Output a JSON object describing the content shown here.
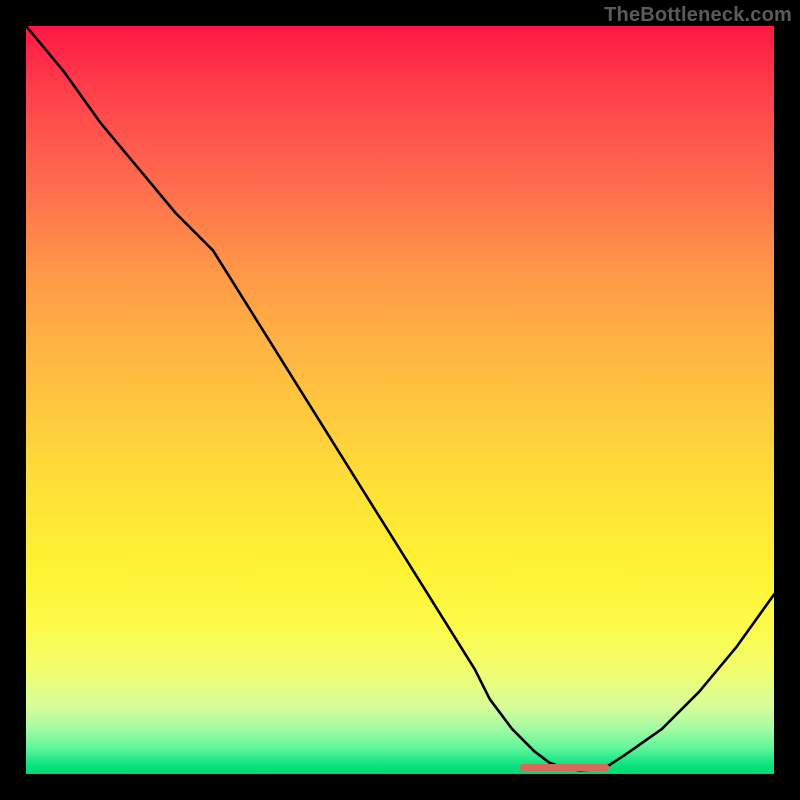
{
  "attribution": "TheBottleneck.com",
  "chart_data": {
    "type": "line",
    "title": "",
    "xlabel": "",
    "ylabel": "",
    "xlim": [
      0,
      100
    ],
    "ylim": [
      0,
      100
    ],
    "x": [
      0,
      5,
      10,
      15,
      20,
      25,
      30,
      35,
      40,
      45,
      50,
      55,
      60,
      62,
      65,
      68,
      70,
      72,
      74,
      76,
      78,
      80,
      85,
      90,
      95,
      100
    ],
    "y": [
      100,
      94,
      87,
      81,
      75,
      70,
      62,
      54,
      46,
      38,
      30,
      22,
      14,
      10,
      6,
      3,
      1.5,
      0.8,
      0.5,
      0.6,
      1.2,
      2.5,
      6,
      11,
      17,
      24
    ],
    "optimal_marker": {
      "x_start": 66,
      "x_end": 78,
      "y": 1.0
    }
  }
}
